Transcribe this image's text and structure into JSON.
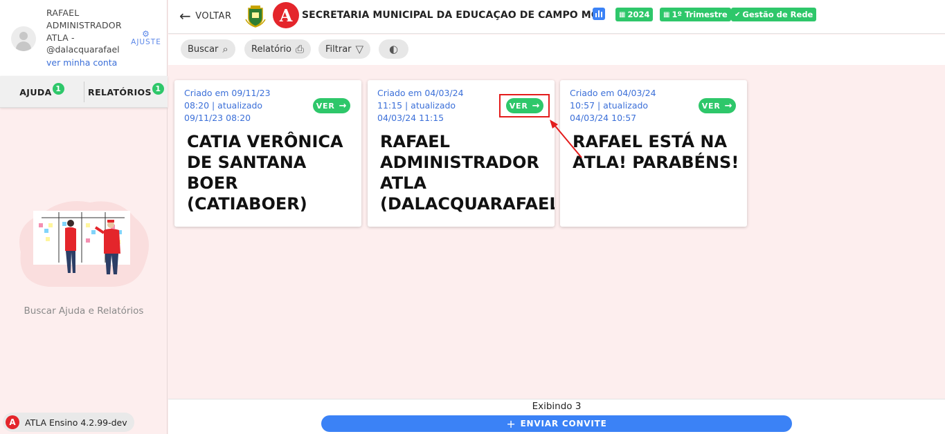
{
  "user": {
    "name": "RAFAEL ADMINISTRADOR ATLA -",
    "handle": "@dalacquarafael",
    "account_link": "ver minha conta",
    "adjust_label": "AJUSTE"
  },
  "sidebar_tabs": [
    {
      "label": "AJUDA",
      "badge": "1"
    },
    {
      "label": "RELATÓRIOS",
      "badge": "1"
    }
  ],
  "sidebar": {
    "help_text": "Buscar Ajuda e Relatórios",
    "version": "ATLA Ensino 4.2.99-dev"
  },
  "header": {
    "back_label": "VOLTAR",
    "logo_glyph": "A",
    "org_title": "SECRETARIA MUNICIPAL DA EDUCAÇAO DE CAMPO MOURÃO",
    "chips": [
      {
        "label": "2024",
        "icon": "calendar-icon"
      },
      {
        "label": "1º Trimestre",
        "icon": "calendar-icon"
      },
      {
        "label": "Gestão de Rede",
        "icon": "check-circle-icon"
      }
    ]
  },
  "toolbar": {
    "search_label": "Buscar",
    "report_label": "Relatório",
    "filter_label": "Filtrar"
  },
  "cards": [
    {
      "meta": "Criado em 09/11/23 08:20 | atualizado 09/11/23 08:20",
      "button": "VER",
      "title": "CATIA VERÔNICA DE SANTANA BOER (CATIABOER)"
    },
    {
      "meta": "Criado em 04/03/24 11:15 | atualizado 04/03/24 11:15",
      "button": "VER",
      "title": "RAFAEL ADMINISTRADOR ATLA (DALACQUARAFAEL)"
    },
    {
      "meta": "Criado em 04/03/24 10:57 | atualizado 04/03/24 10:57",
      "button": "VER",
      "title": "RAFAEL ESTÁ NA ATLA! PARABÉNS!"
    }
  ],
  "footer": {
    "count_text": "Exibindo 3",
    "invite_label": "ENVIAR CONVITE"
  },
  "colors": {
    "accent_green": "#2ec76a",
    "accent_blue": "#3b82f6",
    "brand_red": "#e4252b",
    "background": "#fdeeee"
  }
}
